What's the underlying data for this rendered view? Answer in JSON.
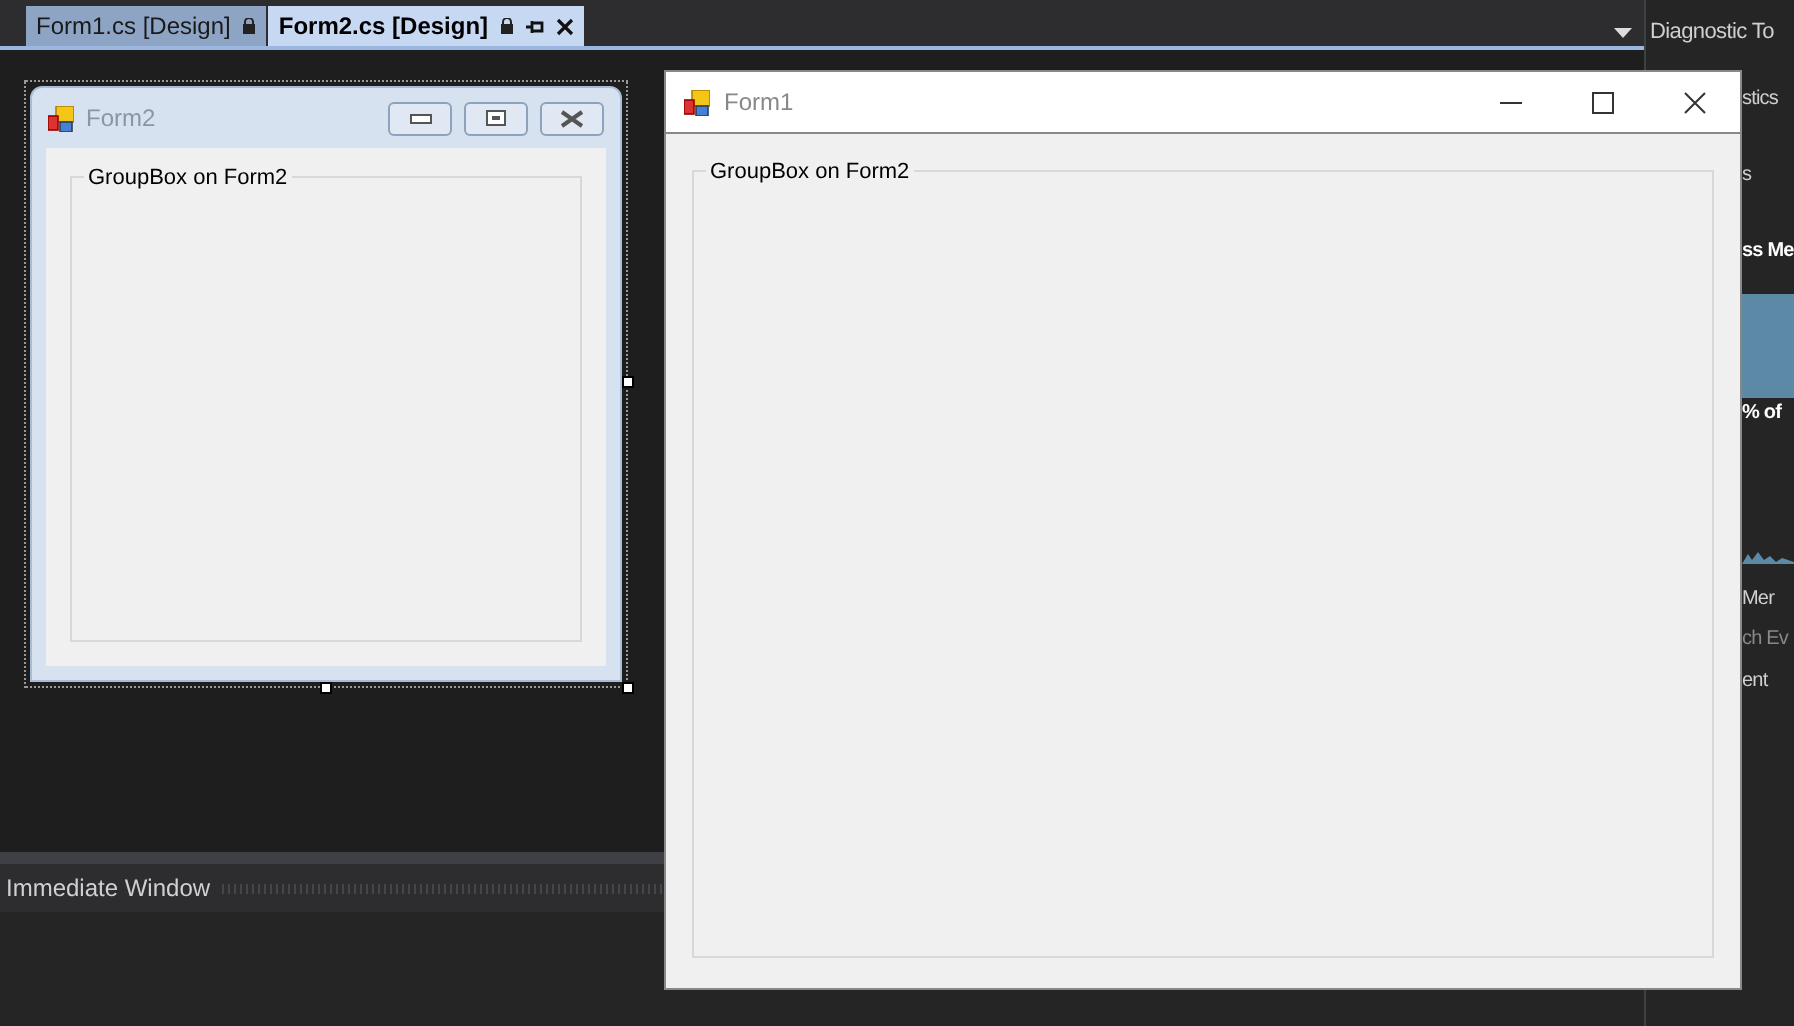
{
  "editor_tabs": [
    {
      "label": "Form1.cs [Design]",
      "selected": false
    },
    {
      "label": "Form2.cs [Design]",
      "selected": true
    }
  ],
  "designer_form": {
    "title": "Form2",
    "group_box": "GroupBox on Form2"
  },
  "immediate_window": {
    "title": "Immediate Window"
  },
  "diagnostic_tools": {
    "title": "Diagnostic To",
    "texts": [
      "stics",
      "s",
      "ss Me",
      "% of",
      "Mer",
      "ch Ev",
      "ent"
    ]
  },
  "running_form": {
    "title": "Form1",
    "group_box": "GroupBox on Form2"
  }
}
